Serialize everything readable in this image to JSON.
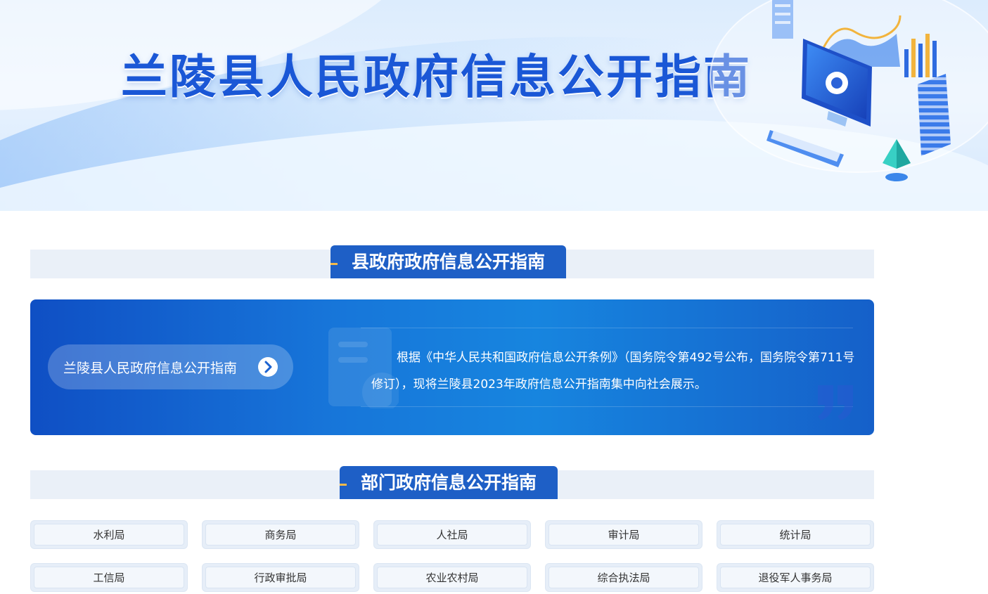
{
  "banner": {
    "title": "兰陵县人民政府信息公开指南"
  },
  "county_section": {
    "heading": "县政府政府信息公开指南",
    "link_label": "兰陵县人民政府信息公开指南",
    "description": "根据《中华人民共和国政府信息公开条例》（国务院令第492号公布，国务院令第711号修订），现将兰陵县2023年政府信息公开指南集中向社会展示。"
  },
  "dept_section": {
    "heading": "部门政府信息公开指南",
    "departments": [
      "水利局",
      "商务局",
      "人社局",
      "审计局",
      "统计局",
      "工信局",
      "行政审批局",
      "农业农村局",
      "综合执法局",
      "退役军人事务局"
    ]
  },
  "colors": {
    "primary_blue": "#1e5fc6",
    "title_blue": "#1a57d6",
    "accent_gold": "#f3b94a"
  },
  "icons": [
    "chevron-right-icon",
    "document-icon",
    "quote-icon",
    "monitor-icon",
    "keyboard-icon",
    "bar-chart-icon"
  ]
}
